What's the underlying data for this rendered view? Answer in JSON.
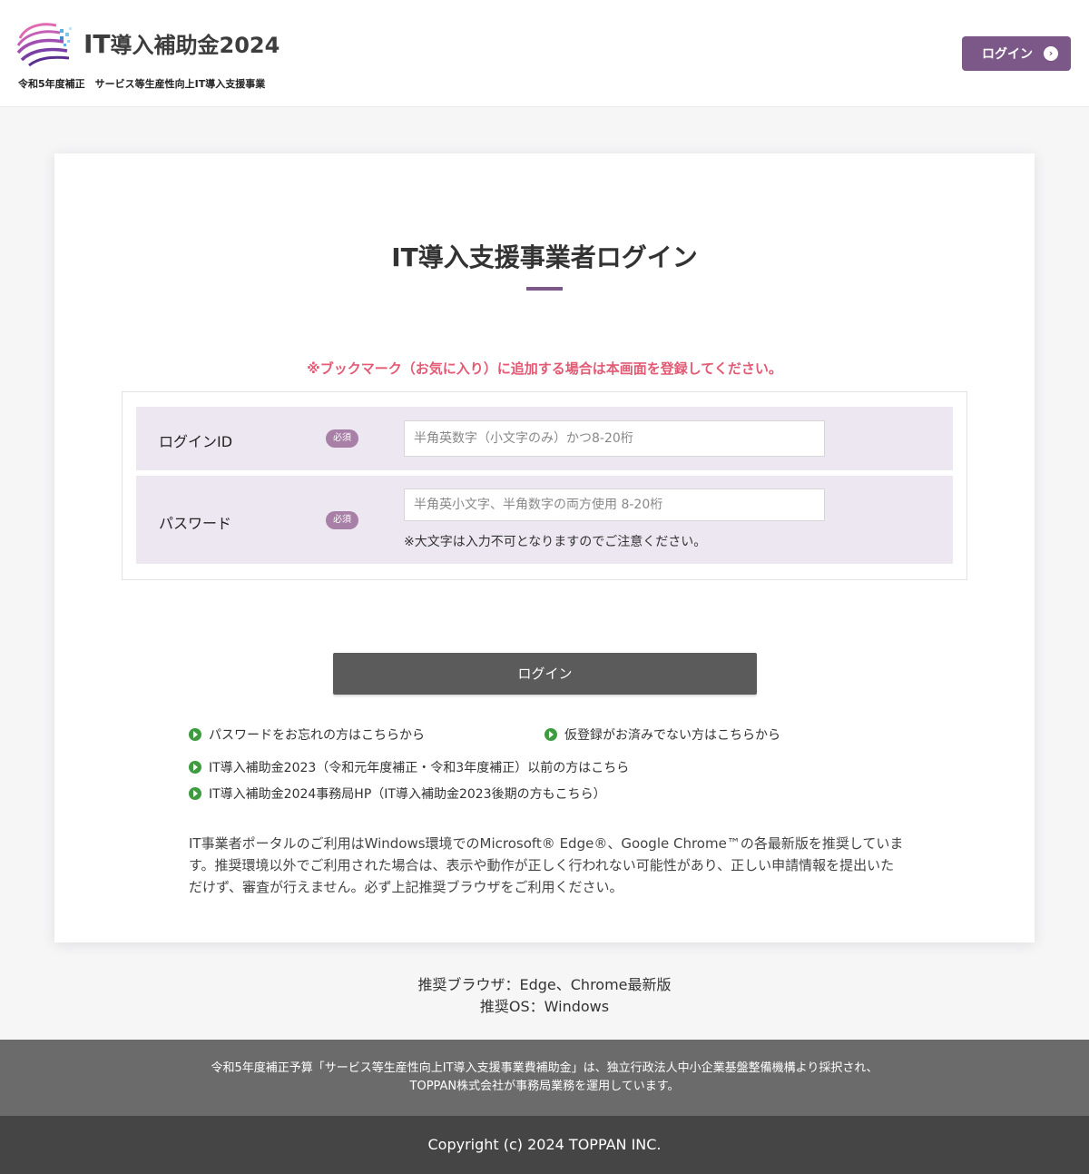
{
  "header": {
    "logo_it": "IT",
    "logo_rest": "導入補助金2024",
    "subtitle": "令和5年度補正　サービス等生産性向上IT導入支援事業",
    "login_label": "ログイン"
  },
  "card": {
    "title": "IT導入支援事業者ログイン",
    "notice": "※ブックマーク（お気に入り）に追加する場合は本画面を登録してください。",
    "fields": [
      {
        "label": "ログインID",
        "required": "必須",
        "placeholder": "半角英数字（小文字のみ）かつ8-20桁"
      },
      {
        "label": "パスワード",
        "required": "必須",
        "placeholder": "半角英小文字、半角数字の両方使用 8-20桁",
        "hint": "※大文字は入力不可となりますのでご注意ください。"
      }
    ],
    "login_button": "ログイン",
    "links": [
      "パスワードをお忘れの方はこちらから",
      "仮登録がお済みでない方はこちらから",
      "IT導入補助金2023（令和元年度補正・令和3年度補正）以前の方はこちら",
      "IT導入補助金2024事務局HP（IT導入補助金2023後期の方もこちら）"
    ],
    "browser_note": "IT事業者ポータルのご利用はWindows環境でのMicrosoft® Edge®、Google Chrome™の各最新版を推奨しています。推奨環境以外でご利用された場合は、表示や動作が正しく行われない可能性があり、正しい申請情報を提出いただけず、審査が行えません。必ず上記推奨ブラウザをご利用ください。"
  },
  "env": {
    "browser": "推奨ブラウザ：Edge、Chrome最新版",
    "os": "推奨OS：Windows"
  },
  "footer": {
    "line1": "令和5年度補正予算「サービス等生産性向上IT導入支援事業費補助金」は、独立行政法人中小企業基盤整備機構より採択され、",
    "line2": "TOPPAN株式会社が事務局業務を運用しています。",
    "copyright": "Copyright (c) 2024 TOPPAN INC."
  },
  "colors": {
    "accent": "#7b5888",
    "notice": "#e25a74",
    "row_bg": "#ece7f1",
    "link_dot": "#3f9b3f",
    "button_bg": "#5b5b5b",
    "footer_top": "#6b6b6b",
    "footer_bottom": "#454545"
  }
}
